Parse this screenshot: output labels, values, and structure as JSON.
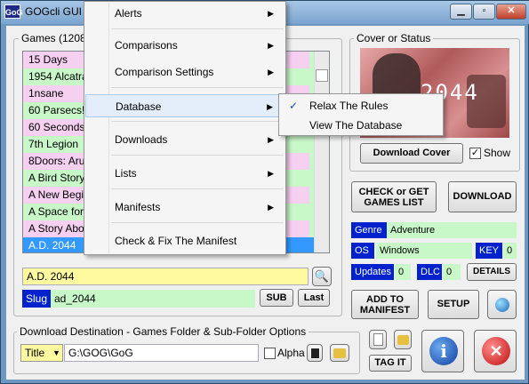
{
  "window": {
    "title": "GOGcli GUI v",
    "app_icon": "GoG"
  },
  "games_group": {
    "label": "Games  (1208)"
  },
  "games": [
    {
      "name": "15 Days",
      "color": "pink"
    },
    {
      "name": "1954 Alcatra",
      "color": "green"
    },
    {
      "name": "1nsane",
      "color": "pink"
    },
    {
      "name": "60 Parsecs!",
      "color": "green"
    },
    {
      "name": "60 Seconds!",
      "color": "pink"
    },
    {
      "name": "7th Legion",
      "color": "green"
    },
    {
      "name": "8Doors: Aru",
      "color": "pink"
    },
    {
      "name": "A Bird Story",
      "color": "green"
    },
    {
      "name": "A New Begi",
      "color": "pink"
    },
    {
      "name": "A Space for",
      "color": "green"
    },
    {
      "name": "A Story Abo",
      "color": "pink"
    },
    {
      "name": "A.D. 2044",
      "color": "selected"
    }
  ],
  "selected_title": "A.D. 2044",
  "slug": {
    "label": "Slug",
    "value": "ad_2044"
  },
  "buttons": {
    "sub": "SUB",
    "last": "Last",
    "download_cover": "Download Cover",
    "check_games": "CHECK or GET GAMES LIST",
    "download": "DOWNLOAD",
    "details": "DETAILS",
    "add_manifest": "ADD TO MANIFEST",
    "setup": "SETUP",
    "tag_it": "TAG IT"
  },
  "cover": {
    "group_label": "Cover or Status",
    "logo_text": "2044",
    "show_label": "Show",
    "show_checked": true
  },
  "info": {
    "genre_label": "Genre",
    "genre": "Adventure",
    "os_label": "OS",
    "os": "Windows",
    "key_label": "KEY",
    "key": "0",
    "updates_label": "Updates",
    "updates": "0",
    "dlc_label": "DLC",
    "dlc": "0"
  },
  "destination": {
    "group_label": "Download Destination - Games Folder & Sub-Folder Options",
    "mode": "Title",
    "path": "G:\\GOG\\GoG",
    "alpha_label": "Alpha",
    "alpha_checked": false
  },
  "menu": {
    "items": [
      {
        "label": "Alerts"
      },
      {
        "label": "Comparisons"
      },
      {
        "label": "Comparison Settings"
      },
      {
        "label": "Database"
      },
      {
        "label": "Downloads"
      },
      {
        "label": "Lists"
      },
      {
        "label": "Manifests"
      },
      {
        "label": "Check & Fix The Manifest"
      }
    ],
    "submenu": [
      {
        "label": "Relax The Rules",
        "checked": true
      },
      {
        "label": "View The Database",
        "checked": false
      }
    ]
  },
  "colors": {
    "pink_row": "#f6d0f0",
    "green_row": "#c8f7c8",
    "selected_row": "#3399ff",
    "title_field": "#fffaa0",
    "label_blue": "#0022cc"
  }
}
